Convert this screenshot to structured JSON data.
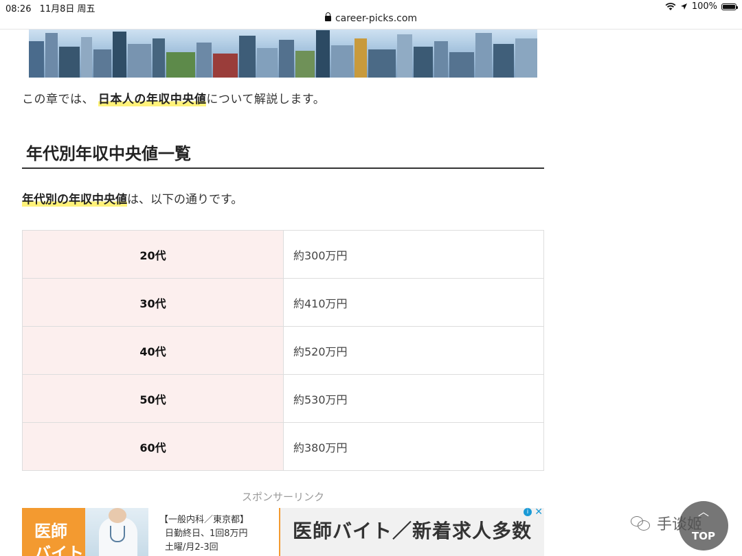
{
  "statusbar": {
    "time": "08:26",
    "date": "11月8日 周五",
    "url": "career-picks.com",
    "battery": "100%",
    "icons": [
      "wifi-icon",
      "location-arrow-icon",
      "battery-icon"
    ]
  },
  "article": {
    "intro_prefix": "この章では、",
    "intro_marker": "日本人の年収中央値",
    "intro_suffix": "について解説します。",
    "heading": "年代別年収中央値一覧",
    "lead_marker": "年代別の年収中央値",
    "lead_suffix": "は、以下の通りです。",
    "table": [
      {
        "age": "20代",
        "value": "約300万円"
      },
      {
        "age": "30代",
        "value": "約410万円"
      },
      {
        "age": "40代",
        "value": "約520万円"
      },
      {
        "age": "50代",
        "value": "約530万円"
      },
      {
        "age": "60代",
        "value": "約380万円"
      }
    ],
    "sponsor_label": "スポンサーリンク"
  },
  "ad": {
    "badge_line1": "医師",
    "badge_line2": "バイト",
    "line1": "【一般内科／東京都】",
    "line2": "日勤終日、1回8万円",
    "line3": "土曜/月2-3回",
    "headline": "医師バイト／新着求人多数",
    "info_icon": "i",
    "close_icon": "✕"
  },
  "overlay": {
    "watermark": "手谈姬",
    "top_button": "TOP"
  },
  "colors": {
    "marker": "#fff27a",
    "table_header_bg": "#fcefee",
    "ad_orange": "#f39a30"
  }
}
